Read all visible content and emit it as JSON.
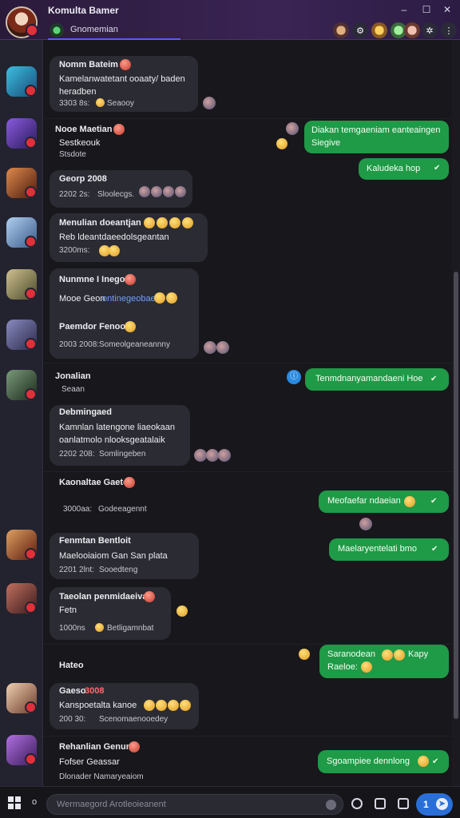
{
  "window": {
    "title": "Komulta Bamer",
    "channel": "Gnomemian",
    "controls": {
      "minimize": "–",
      "maximize": "☐",
      "close": "✕"
    }
  },
  "bottom": {
    "left_glyph": "o",
    "input_placeholder": "Wermaegord Arotleoieanent",
    "badge_count": "1"
  },
  "messages": {
    "m1": {
      "name": "Nomm Bateim",
      "line1": "Kamelanwatetant ooaaty/ baden",
      "line2": "heradben",
      "time": "3303 8s:",
      "link": "Seaooy"
    },
    "m2": {
      "name": "Nooe Maetian",
      "line1": "Sestkeouk",
      "line2": "Stsdote"
    },
    "m3": {
      "name": "Georp 2008",
      "time": "2202 2s:",
      "link": "Sloolecgs."
    },
    "m4": {
      "name": "Menulian doeantjan",
      "line1": "Reb ldeantdaeedolsgeantan",
      "time": "3200ms:"
    },
    "m5": {
      "name": "Nunmne I Inego",
      "line1": "Mooe Geon",
      "link1": "ontinegeobae",
      "name2": "Paemdor Fenoo",
      "time": "2003 2008:",
      "link2": "Someolgeaneannny"
    },
    "m6": {
      "name": "Jonalian",
      "line1": "Seaan"
    },
    "m7": {
      "name": "Debmingaed",
      "line1": "Kamnlan latengone liaeokaan",
      "line2": "oanlatmolo nlooksgeatalaik",
      "time": "2202 208:",
      "link": "Somlingeben"
    },
    "m8": {
      "name": "Kaonaltae Gaeter",
      "time": "3000aa:",
      "link": "Godeeagennt"
    },
    "m9": {
      "name": "Fenmtan Bentloit",
      "line1": "Maelooiaiom Gan San plata",
      "time": "2201 2lnt:",
      "link": "Sooedteng"
    },
    "m10": {
      "name": "Taeolan penmidaeiva",
      "line1": "Fetn",
      "time": "1000ns",
      "link": "Betligamnbat"
    },
    "m11": {
      "name": "Hateo"
    },
    "m12": {
      "name": "Gaeso",
      "name_tag": "3008",
      "line1": "Kanspoetalta kanoe",
      "time": "200 30:",
      "link": "Scenomaenooedey"
    },
    "m13": {
      "name": "Rehanlian Genun",
      "line1": "Fofser Geassar",
      "line2": "Dlonader Namaryeaiom"
    }
  },
  "outgoing": {
    "o1": {
      "line1": "Diakan temgaeniam eanteaingen",
      "line2": "Siegive"
    },
    "o2": {
      "text": "Kaludeka hop"
    },
    "o3": {
      "text": "Tenmdnanyamandaeni Hoe"
    },
    "o4": {
      "text": "Meofaefar ndaeian"
    },
    "o5": {
      "text": "Maelaryentelati bmo"
    },
    "o6": {
      "line1": "Saranodean",
      "line2": "Raeloe:",
      "line1_tail": "Kapy"
    },
    "o7": {
      "text": "Sgoampiee dennlong"
    }
  },
  "colors": {
    "accent": "#1f9a46",
    "incoming": "#2b2b33",
    "link": "#6fa0ff",
    "badge": "#2a6fd8"
  }
}
